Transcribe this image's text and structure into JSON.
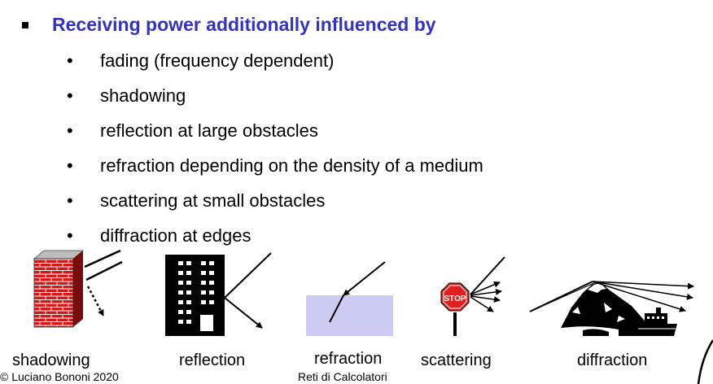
{
  "slide": {
    "heading": "Receiving power additionally influenced by",
    "bullets": [
      "fading (frequency dependent)",
      "shadowing",
      "reflection at large obstacles",
      "refraction depending on the density of a medium",
      "scattering at small obstacles",
      "diffraction at edges"
    ],
    "bullet_glyph": "•",
    "heading_color": "#3333bb"
  },
  "figures": {
    "labels": [
      "shadowing",
      "reflection",
      "refraction",
      "scattering",
      "diffraction"
    ],
    "stop_sign_text": "STOP",
    "icons": [
      "brick-wall-icon",
      "building-icon",
      "water-medium-icon",
      "stop-sign-icon",
      "mountain-ship-icon"
    ]
  },
  "footer": {
    "copyright": "© Luciano Bononi 2020",
    "course": "Reti di Calcolatori"
  }
}
